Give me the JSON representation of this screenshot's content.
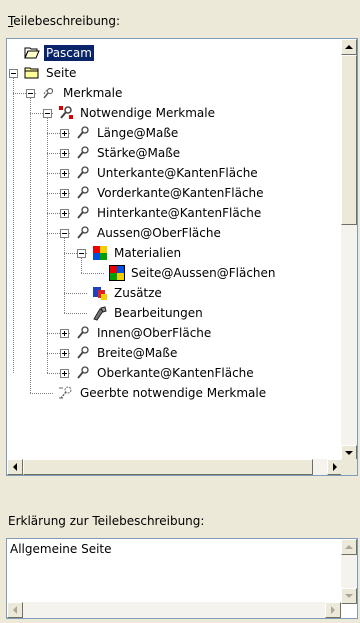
{
  "tree_panel": {
    "label_mnemonic": "T",
    "label_rest": "eilebeschreibung:"
  },
  "tree": {
    "rows": [
      {
        "label": "Pascam",
        "level": 0,
        "expander": "",
        "icon": "open-folder-icon",
        "selected": true
      },
      {
        "label": "Seite",
        "level": 0,
        "expander": "minus",
        "icon": "folder-icon",
        "selected": false
      },
      {
        "label": "Merkmale",
        "level": 1,
        "expander": "minus",
        "icon": "features-icon",
        "selected": false
      },
      {
        "label": "Notwendige Merkmale",
        "level": 2,
        "expander": "minus",
        "icon": "required-features-icon",
        "selected": false
      },
      {
        "label": "Länge@Maße",
        "level": 3,
        "expander": "plus",
        "icon": "feature-icon",
        "selected": false
      },
      {
        "label": "Stärke@Maße",
        "level": 3,
        "expander": "plus",
        "icon": "feature-icon",
        "selected": false
      },
      {
        "label": "Unterkante@KantenFläche",
        "level": 3,
        "expander": "plus",
        "icon": "feature-icon",
        "selected": false
      },
      {
        "label": "Vorderkante@KantenFläche",
        "level": 3,
        "expander": "plus",
        "icon": "feature-icon",
        "selected": false
      },
      {
        "label": "Hinterkante@KantenFläche",
        "level": 3,
        "expander": "plus",
        "icon": "feature-icon",
        "selected": false
      },
      {
        "label": "Aussen@OberFläche",
        "level": 3,
        "expander": "minus",
        "icon": "feature-icon",
        "selected": false
      },
      {
        "label": "Materialien",
        "level": 4,
        "expander": "minus",
        "icon": "materials-icon",
        "selected": false
      },
      {
        "label": "Seite@Aussen@Flächen",
        "level": 5,
        "expander": "",
        "icon": "material-icon",
        "selected": false
      },
      {
        "label": "Zusätze",
        "level": 4,
        "expander": "",
        "icon": "additions-icon",
        "selected": false
      },
      {
        "label": "Bearbeitungen",
        "level": 4,
        "expander": "",
        "icon": "processing-icon",
        "selected": false
      },
      {
        "label": "Innen@OberFläche",
        "level": 3,
        "expander": "plus",
        "icon": "feature-icon",
        "selected": false
      },
      {
        "label": "Breite@Maße",
        "level": 3,
        "expander": "plus",
        "icon": "feature-icon",
        "selected": false
      },
      {
        "label": "Oberkante@KantenFläche",
        "level": 3,
        "expander": "plus",
        "icon": "feature-icon",
        "selected": false
      },
      {
        "label": "Geerbte notwendige Merkmale",
        "level": 2,
        "expander": "",
        "icon": "inherited-features-icon",
        "selected": false
      }
    ]
  },
  "description_panel": {
    "label": "Erklärung zur Teilebeschreibung:",
    "text": "Allgemeine Seite"
  },
  "colors": {
    "window_bg": "#ece9d8",
    "selection_bg": "#0a246a",
    "field_border": "#7f9db9"
  }
}
